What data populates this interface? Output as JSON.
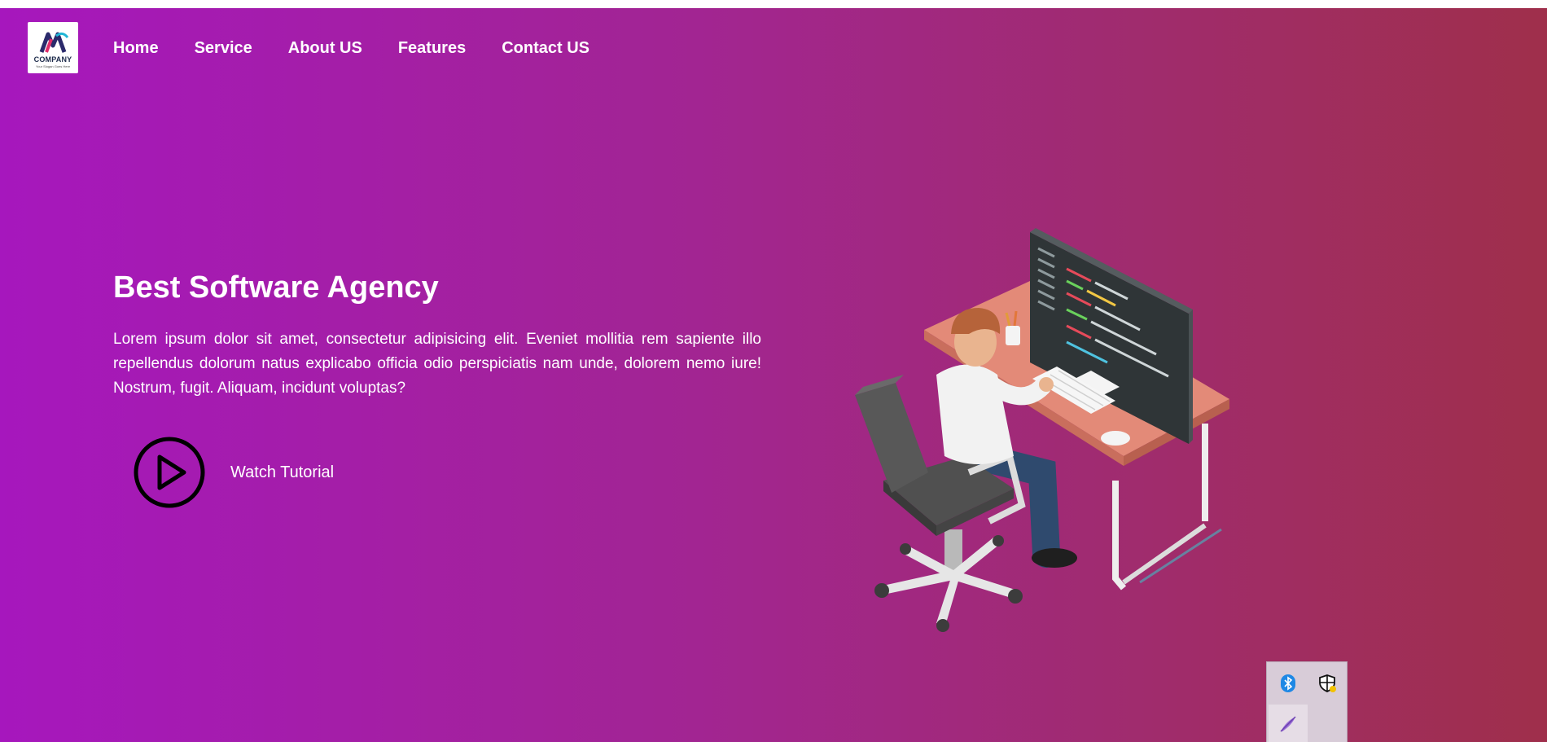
{
  "logo": {
    "brand": "COMPANY",
    "tagline": "Your Slogan Goes Here"
  },
  "nav": {
    "items": [
      {
        "label": "Home"
      },
      {
        "label": "Service"
      },
      {
        "label": "About US"
      },
      {
        "label": "Features"
      },
      {
        "label": "Contact US"
      }
    ]
  },
  "hero": {
    "title": "Best Software Agency",
    "body": "Lorem ipsum dolor sit amet, consectetur adipisicing elit. Eveniet mollitia rem sapiente illo repellendus dolorum natus explicabo officia odio perspiciatis nam unde, dolorem nemo iure! Nostrum, fugit. Aliquam, incidunt voluptas?",
    "watch_label": "Watch Tutorial",
    "watch_icon": "play-icon"
  },
  "illustration": {
    "icon": "developer-at-desk-illustration"
  },
  "tray": {
    "icons": [
      "bluetooth-icon",
      "security-shield-icon",
      "pen-icon"
    ]
  },
  "colors": {
    "gradient_start": "#a617bd",
    "gradient_end": "#9f2f4b",
    "text": "#ffffff",
    "desk": "#e38a78",
    "monitor": "#333a3d"
  }
}
